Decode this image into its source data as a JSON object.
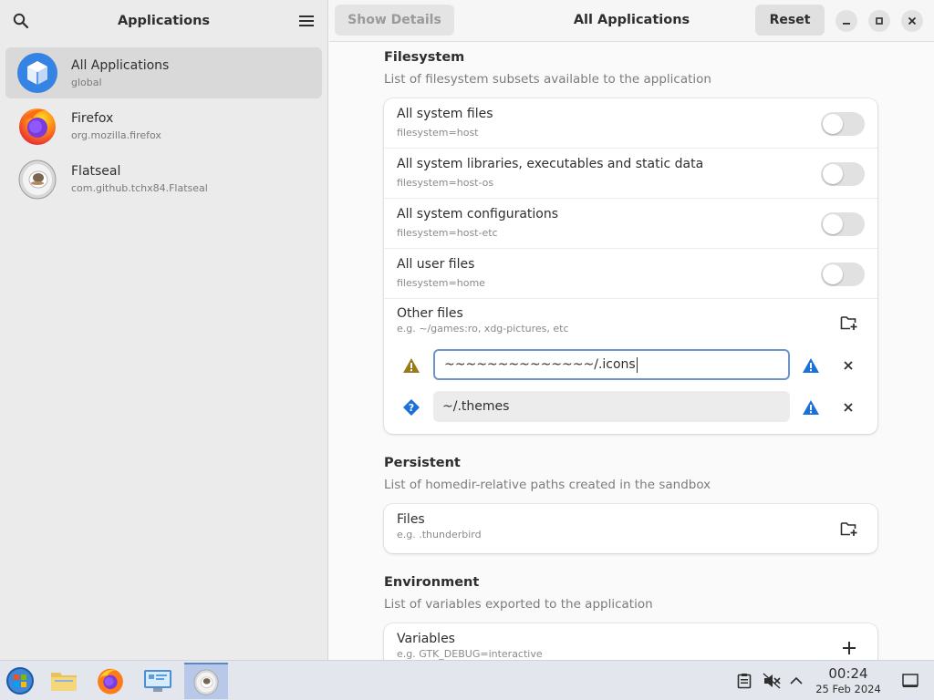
{
  "sidebar": {
    "title": "Applications",
    "apps": [
      {
        "name": "All Applications",
        "id": "global"
      },
      {
        "name": "Firefox",
        "id": "org.mozilla.firefox"
      },
      {
        "name": "Flatseal",
        "id": "com.github.tchx84.Flatseal"
      }
    ]
  },
  "header": {
    "show_details_label": "Show Details",
    "title": "All Applications",
    "reset_label": "Reset"
  },
  "filesystem": {
    "title": "Filesystem",
    "subtitle": "List of filesystem subsets available to the application",
    "rows": [
      {
        "title": "All system files",
        "sub": "filesystem=host",
        "enabled": false
      },
      {
        "title": "All system libraries, executables and static data",
        "sub": "filesystem=host-os",
        "enabled": false
      },
      {
        "title": "All system configurations",
        "sub": "filesystem=host-etc",
        "enabled": false
      },
      {
        "title": "All user files",
        "sub": "filesystem=home",
        "enabled": false
      }
    ],
    "other_files": {
      "title": "Other files",
      "placeholder": "e.g. ~/games:ro, xdg-pictures, etc",
      "entries": [
        {
          "value": "~~~~~~~~~~~~~~/.icons",
          "status": "warning"
        },
        {
          "value": "~/.themes",
          "status": "unknown"
        }
      ]
    }
  },
  "persistent": {
    "title": "Persistent",
    "subtitle": "List of homedir-relative paths created in the sandbox",
    "files_title": "Files",
    "files_placeholder": "e.g. .thunderbird"
  },
  "environment": {
    "title": "Environment",
    "subtitle": "List of variables exported to the application",
    "variables_title": "Variables",
    "variables_placeholder": "e.g. GTK_DEBUG=interactive"
  },
  "taskbar": {
    "time": "00:24",
    "date": "25 Feb 2024"
  },
  "colors": {
    "accent": "#3584e4",
    "warning": "#9a7b1a",
    "info_blue": "#1c71d8"
  }
}
